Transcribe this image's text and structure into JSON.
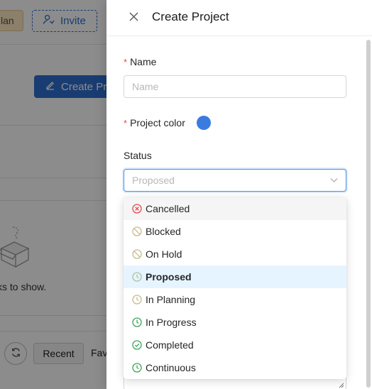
{
  "background": {
    "plan_badge": "lan",
    "invite_label": "Invite",
    "create_button_label": "Create Pro",
    "empty_text": "ks to show.",
    "recent_tab": "Recent",
    "fav_tab": "Fav"
  },
  "drawer": {
    "title": "Create Project",
    "name_field": {
      "label": "Name",
      "placeholder": "Name",
      "value": "",
      "required": true
    },
    "color_field": {
      "label": "Project color",
      "value": "#3a7be0",
      "required": true
    },
    "status_field": {
      "label": "Status",
      "placeholder": "Proposed"
    }
  },
  "status_options": [
    {
      "label": "Cancelled",
      "icon": "cancelled-icon",
      "color": "#e5484d",
      "state": "hovered"
    },
    {
      "label": "Blocked",
      "icon": "blocked-icon",
      "color": "#c9b98a",
      "state": ""
    },
    {
      "label": "On Hold",
      "icon": "on-hold-icon",
      "color": "#c9b98a",
      "state": ""
    },
    {
      "label": "Proposed",
      "icon": "proposed-icon",
      "color": "#a8c4a0",
      "state": "selected"
    },
    {
      "label": "In Planning",
      "icon": "in-planning-icon",
      "color": "#c9b98a",
      "state": ""
    },
    {
      "label": "In Progress",
      "icon": "in-progress-icon",
      "color": "#3aa55d",
      "state": ""
    },
    {
      "label": "Completed",
      "icon": "completed-icon",
      "color": "#3aa55d",
      "state": ""
    },
    {
      "label": "Continuous",
      "icon": "continuous-icon",
      "color": "#3aa55d",
      "state": ""
    }
  ]
}
